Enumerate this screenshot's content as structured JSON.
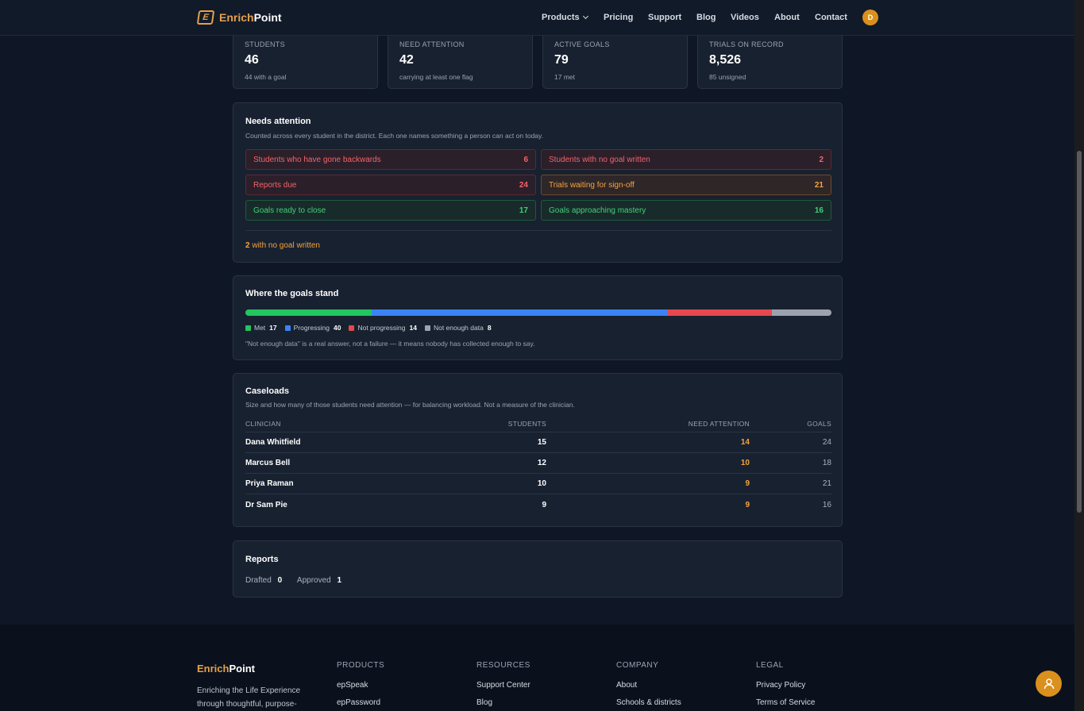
{
  "nav": {
    "brand_a": "Enrich",
    "brand_b": "Point",
    "logo_glyph": "E",
    "links": [
      "Products",
      "Pricing",
      "Support",
      "Blog",
      "Videos",
      "About",
      "Contact"
    ],
    "avatar": "D"
  },
  "stats": [
    {
      "label": "STUDENTS",
      "value": "46",
      "sub": "44 with a goal"
    },
    {
      "label": "NEED ATTENTION",
      "value": "42",
      "sub": "carrying at least one flag"
    },
    {
      "label": "ACTIVE GOALS",
      "value": "79",
      "sub": "17 met"
    },
    {
      "label": "TRIALS ON RECORD",
      "value": "8,526",
      "sub": "85 unsigned"
    }
  ],
  "attention": {
    "title": "Needs attention",
    "desc": "Counted across every student in the district. Each one names something a person can act on today.",
    "flags": [
      {
        "label": "Students who have gone backwards",
        "count": "6",
        "tone": "red"
      },
      {
        "label": "Students with no goal written",
        "count": "2",
        "tone": "red"
      },
      {
        "label": "Reports due",
        "count": "24",
        "tone": "red"
      },
      {
        "label": "Trials waiting for sign-off",
        "count": "21",
        "tone": "orange"
      },
      {
        "label": "Goals ready to close",
        "count": "17",
        "tone": "green"
      },
      {
        "label": "Goals approaching mastery",
        "count": "16",
        "tone": "green"
      }
    ],
    "footer_count": "2",
    "footer_text": " with no goal written"
  },
  "goals": {
    "title": "Where the goals stand",
    "segments": [
      {
        "label": "Met",
        "value": 17,
        "color": "#22c55e"
      },
      {
        "label": "Progressing",
        "value": 40,
        "color": "#3b82f6"
      },
      {
        "label": "Not progressing",
        "value": 14,
        "color": "#e5484d"
      },
      {
        "label": "Not enough data",
        "value": 8,
        "color": "#9ca3af"
      }
    ],
    "note": "\"Not enough data\" is a real answer, not a failure — it means nobody has collected enough to say."
  },
  "caseloads": {
    "title": "Caseloads",
    "desc": "Size and how many of those students need attention — for balancing workload. Not a measure of the clinician.",
    "headers": [
      "CLINICIAN",
      "STUDENTS",
      "NEED ATTENTION",
      "GOALS"
    ],
    "rows": [
      [
        "Dana Whitfield",
        "15",
        "14",
        "24"
      ],
      [
        "Marcus Bell",
        "12",
        "10",
        "18"
      ],
      [
        "Priya Raman",
        "10",
        "9",
        "21"
      ],
      [
        "Dr Sam Pie",
        "9",
        "9",
        "16"
      ]
    ]
  },
  "reports": {
    "title": "Reports",
    "drafted_label": "Drafted",
    "drafted": "0",
    "approved_label": "Approved",
    "approved": "1"
  },
  "footer": {
    "brand_a": "Enrich",
    "brand_b": "Point",
    "tagline": "Enriching the Life Experience through thoughtful, purpose-",
    "cols": [
      {
        "h": "PRODUCTS",
        "items": [
          "epSpeak",
          "epPassword"
        ]
      },
      {
        "h": "RESOURCES",
        "items": [
          "Support Center",
          "Blog"
        ]
      },
      {
        "h": "COMPANY",
        "items": [
          "About",
          "Schools & districts"
        ]
      },
      {
        "h": "LEGAL",
        "items": [
          "Privacy Policy",
          "Terms of Service"
        ]
      }
    ]
  }
}
